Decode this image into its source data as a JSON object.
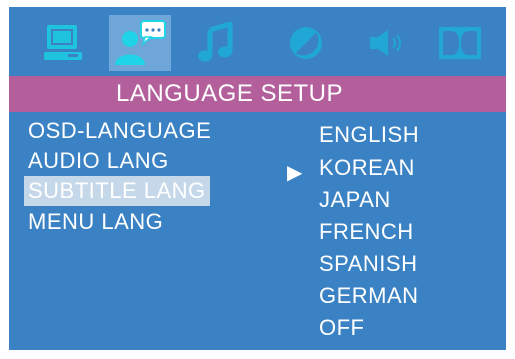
{
  "icons": {
    "items": [
      {
        "name": "general-setup",
        "icon": "monitor-icon",
        "active": false
      },
      {
        "name": "language-setup",
        "icon": "person-speech-icon",
        "active": true
      },
      {
        "name": "audio-setup",
        "icon": "music-note-icon",
        "active": false
      },
      {
        "name": "video-setup",
        "icon": "contrast-icon",
        "active": false
      },
      {
        "name": "speaker-setup",
        "icon": "speaker-icon",
        "active": false
      },
      {
        "name": "dolby-setup",
        "icon": "dolby-icon",
        "active": false
      }
    ],
    "active_color": "#1fd4e6",
    "inactive_color": "#20a7d6"
  },
  "title": "LANGUAGE SETUP",
  "menu": {
    "items": [
      {
        "label": "OSD-LANGUAGE",
        "selected": false
      },
      {
        "label": "AUDIO LANG",
        "selected": false
      },
      {
        "label": "SUBTITLE LANG",
        "selected": true
      },
      {
        "label": "MENU LANG",
        "selected": false
      }
    ]
  },
  "options": {
    "items": [
      "ENGLISH",
      "KOREAN",
      "JAPAN",
      "FRENCH",
      "SPANISH",
      "GERMAN",
      "OFF"
    ],
    "current": "KOREAN",
    "pointer_glyph": "▶"
  },
  "colors": {
    "background": "#3a82c4",
    "title_bar": "#b25f9c",
    "selection": "#c5d8ea",
    "text": "#ffffff"
  }
}
